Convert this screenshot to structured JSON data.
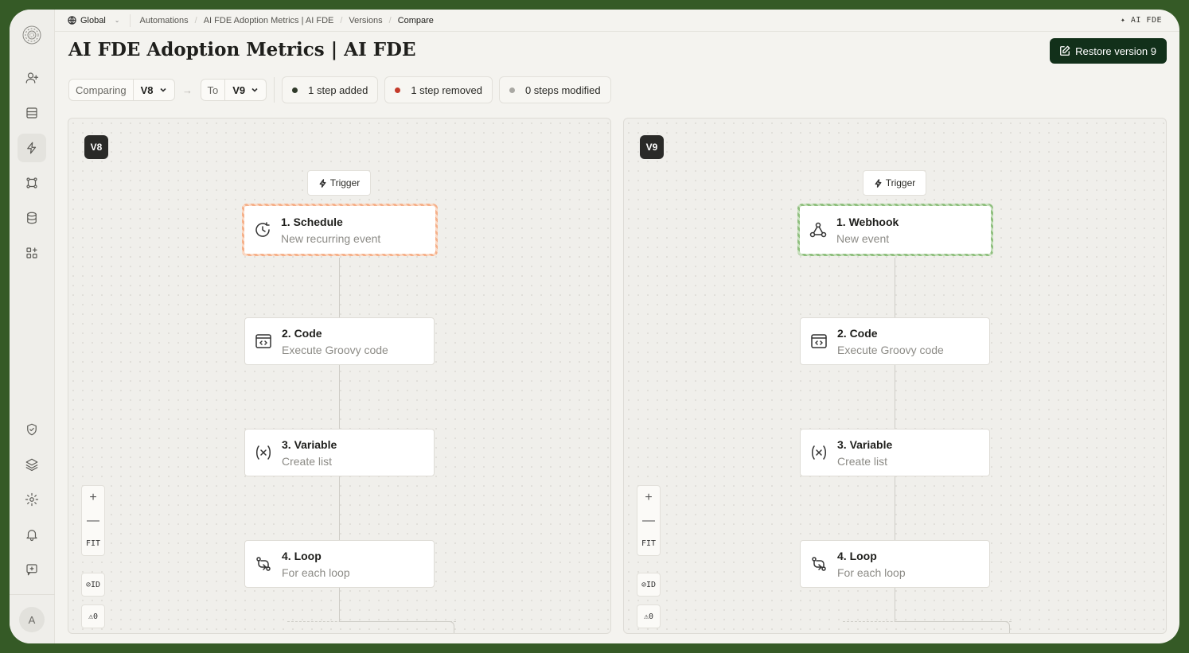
{
  "topbar": {
    "scope": "Global",
    "breadcrumbs": [
      "Automations",
      "AI FDE Adoption Metrics | AI FDE",
      "Versions",
      "Compare"
    ],
    "brand": "✦ AI FDE"
  },
  "header": {
    "title": "AI FDE Adoption Metrics | AI FDE",
    "restore_label": "Restore version 9"
  },
  "compare": {
    "from_label": "Comparing",
    "from_value": "V8",
    "to_label": "To",
    "to_value": "V9",
    "stats": [
      {
        "label": "1 step added",
        "color": "#2f3a2a"
      },
      {
        "label": "1 step removed",
        "color": "#c43a2a"
      },
      {
        "label": "0 steps modified",
        "color": "#a9a8a3"
      }
    ]
  },
  "panels": [
    {
      "version": "V8",
      "trigger": "Trigger",
      "nodes": [
        {
          "title": "1. Schedule",
          "subtitle": "New recurring event",
          "icon": "clock-icon",
          "state": "removed"
        },
        {
          "title": "2. Code",
          "subtitle": "Execute Groovy code",
          "icon": "code-icon",
          "state": "unchanged"
        },
        {
          "title": "3. Variable",
          "subtitle": "Create list",
          "icon": "variable-icon",
          "state": "unchanged"
        },
        {
          "title": "4. Loop",
          "subtitle": "For each loop",
          "icon": "loop-icon",
          "state": "unchanged"
        }
      ],
      "controls": {
        "zoom_in": "+",
        "zoom_out": "—",
        "fit": "FIT",
        "id": "⊘ID",
        "warnings": "⚠0"
      }
    },
    {
      "version": "V9",
      "trigger": "Trigger",
      "nodes": [
        {
          "title": "1. Webhook",
          "subtitle": "New event",
          "icon": "webhook-icon",
          "state": "added"
        },
        {
          "title": "2. Code",
          "subtitle": "Execute Groovy code",
          "icon": "code-icon",
          "state": "unchanged"
        },
        {
          "title": "3. Variable",
          "subtitle": "Create list",
          "icon": "variable-icon",
          "state": "unchanged"
        },
        {
          "title": "4. Loop",
          "subtitle": "For each loop",
          "icon": "loop-icon",
          "state": "unchanged"
        }
      ],
      "controls": {
        "zoom_in": "+",
        "zoom_out": "—",
        "fit": "FIT",
        "id": "⊘ID",
        "warnings": "⚠0"
      }
    }
  ],
  "sidebar": {
    "items": [
      "user-add-icon",
      "inbox-icon",
      "bolt-icon",
      "nodes-icon",
      "database-icon",
      "apps-icon"
    ],
    "bottom_items": [
      "shield-icon",
      "layers-icon",
      "gear-icon",
      "bell-icon",
      "feedback-icon"
    ],
    "avatar_initial": "A"
  }
}
